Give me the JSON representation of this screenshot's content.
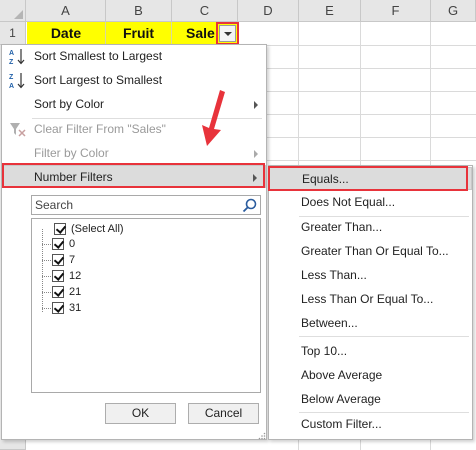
{
  "columns": [
    "A",
    "B",
    "C",
    "D",
    "E",
    "F",
    "G"
  ],
  "rows": [
    "1"
  ],
  "header_cells": [
    "Date",
    "Fruit",
    "Sale"
  ],
  "menu": [
    {
      "label": "Sort Smallest to Largest",
      "icon": "sort-ascending-icon",
      "disabled": false,
      "submenu": false
    },
    {
      "label": "Sort Largest to Smallest",
      "icon": "sort-descending-icon",
      "disabled": false,
      "submenu": false
    },
    {
      "label": "Sort by Color",
      "disabled": false,
      "submenu": true
    },
    {
      "label": "Clear Filter From \"Sales\"",
      "icon": "clear-filter-icon",
      "disabled": true,
      "submenu": false
    },
    {
      "label": "Filter by Color",
      "disabled": true,
      "submenu": true
    },
    {
      "label": "Number Filters",
      "disabled": false,
      "submenu": true,
      "highlighted": true
    }
  ],
  "search": {
    "placeholder": "Search",
    "icon": "search-icon"
  },
  "list_items": [
    "(Select All)",
    "0",
    "7",
    "12",
    "21",
    "31"
  ],
  "buttons": {
    "ok": "OK",
    "cancel": "Cancel"
  },
  "submenu": [
    "Equals...",
    "Does Not Equal...",
    "Greater Than...",
    "Greater Than Or Equal To...",
    "Less Than...",
    "Less Than Or Equal To...",
    "Between...",
    "Top 10...",
    "Above Average",
    "Below Average",
    "Custom Filter..."
  ],
  "colors": {
    "header_fill": "#ffff00",
    "highlight_border": "#e8333b",
    "menu_highlight": "#dcdcdc"
  }
}
